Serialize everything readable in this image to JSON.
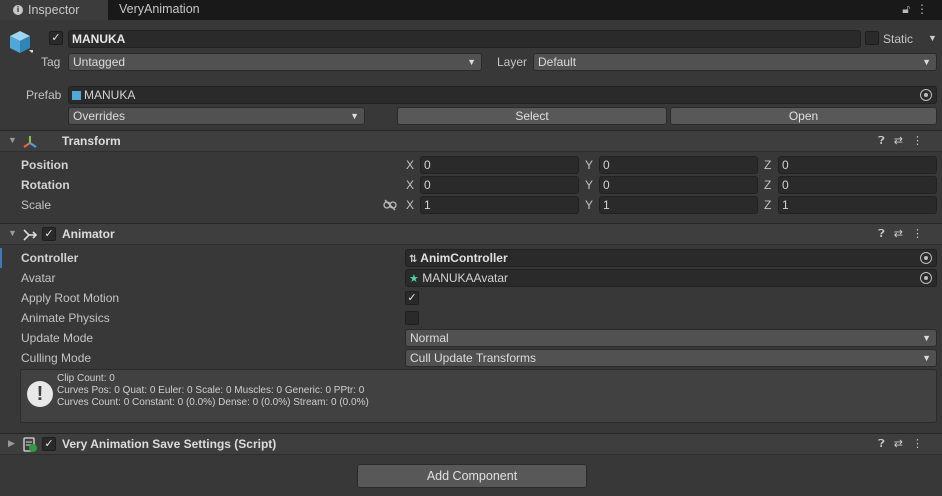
{
  "tabs": [
    {
      "label": "Inspector",
      "icon": "info-icon",
      "active": true
    },
    {
      "label": "VeryAnimation",
      "active": false
    }
  ],
  "gameobject": {
    "name": "MANUKA",
    "static_label": "Static",
    "tag_label": "Tag",
    "tag_value": "Untagged",
    "layer_label": "Layer",
    "layer_value": "Default",
    "prefab_label": "Prefab",
    "prefab_value": "MANUKA",
    "overrides_label": "Overrides",
    "select_label": "Select",
    "open_label": "Open"
  },
  "transform": {
    "title": "Transform",
    "position_label": "Position",
    "rotation_label": "Rotation",
    "scale_label": "Scale",
    "axis_x": "X",
    "axis_y": "Y",
    "axis_z": "Z",
    "position": {
      "x": "0",
      "y": "0",
      "z": "0"
    },
    "rotation": {
      "x": "0",
      "y": "0",
      "z": "0"
    },
    "scale": {
      "x": "1",
      "y": "1",
      "z": "1"
    }
  },
  "animator": {
    "title": "Animator",
    "controller_label": "Controller",
    "controller_value": "AnimController",
    "avatar_label": "Avatar",
    "avatar_value": "MANUKAAvatar",
    "apply_root_motion_label": "Apply Root Motion",
    "apply_root_motion": true,
    "animate_physics_label": "Animate Physics",
    "animate_physics": false,
    "update_mode_label": "Update Mode",
    "update_mode_value": "Normal",
    "culling_mode_label": "Culling Mode",
    "culling_mode_value": "Cull Update Transforms",
    "info_line1": "Clip Count: 0",
    "info_line2": "Curves Pos: 0 Quat: 0 Euler: 0 Scale: 0 Muscles: 0 Generic: 0 PPtr: 0",
    "info_line3": "Curves Count: 0 Constant: 0 (0.0%) Dense: 0 (0.0%) Stream: 0 (0.0%)"
  },
  "script_component": {
    "title": "Very Animation Save Settings (Script)"
  },
  "add_component_label": "Add Component",
  "colors": {
    "background": "#383838",
    "field": "#2a2a2a",
    "header": "#3e3e3e",
    "accent_selection": "#3a79bb"
  }
}
